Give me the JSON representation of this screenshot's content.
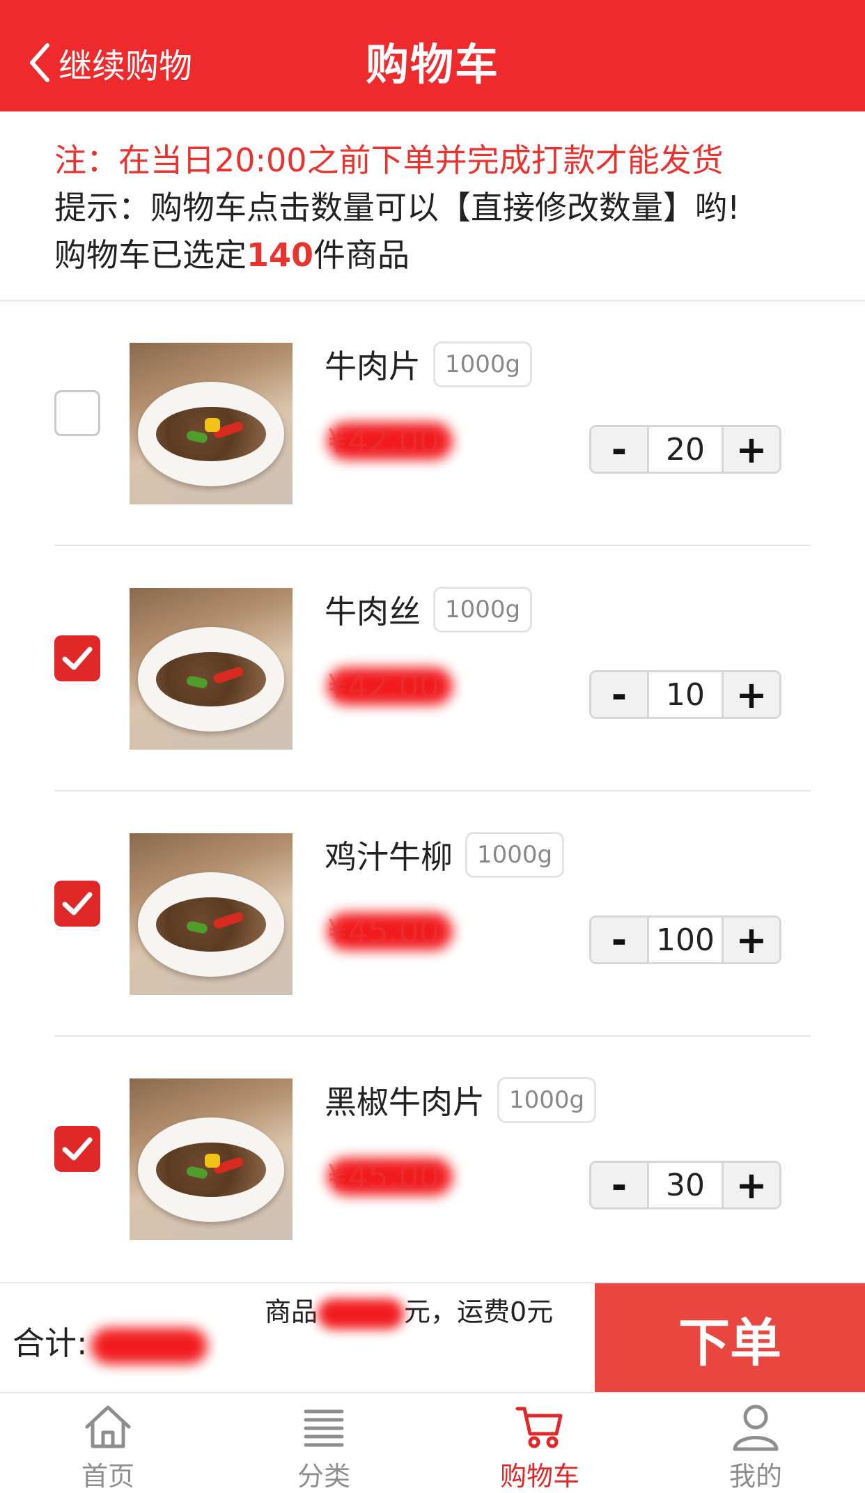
{
  "header": {
    "back_label": "继续购物",
    "title": "购物车"
  },
  "notice": {
    "note": "注：在当日20:00之前下单并完成打款才能发货",
    "tip": "提示：购物车点击数量可以【直接修改数量】哟!",
    "selected_prefix": "购物车已选定",
    "selected_count": "140",
    "selected_suffix": "件商品"
  },
  "items": [
    {
      "name": "牛肉片",
      "tag": "1000g",
      "price": "¥42.00",
      "qty": "20",
      "checked": false
    },
    {
      "name": "牛肉丝",
      "tag": "1000g",
      "price": "¥42.00",
      "qty": "10",
      "checked": true
    },
    {
      "name": "鸡汁牛柳",
      "tag": "1000g",
      "price": "¥45.00",
      "qty": "100",
      "checked": true
    },
    {
      "name": "黑椒牛肉片",
      "tag": "1000g",
      "price": "¥45.00",
      "qty": "30",
      "checked": true
    }
  ],
  "stepper": {
    "minus": "-",
    "plus": "+"
  },
  "footer": {
    "total_label": "合计:",
    "summary_prefix": "商品",
    "summary_suffix": "元，运费0元",
    "order_button": "下单"
  },
  "tabs": [
    {
      "label": "首页",
      "icon": "home-icon"
    },
    {
      "label": "分类",
      "icon": "list-icon"
    },
    {
      "label": "购物车",
      "icon": "cart-icon",
      "active": true
    },
    {
      "label": "我的",
      "icon": "user-icon"
    }
  ],
  "colors": {
    "brand": "#ee2a2c",
    "accent": "#e02828",
    "order": "#e8463e"
  }
}
